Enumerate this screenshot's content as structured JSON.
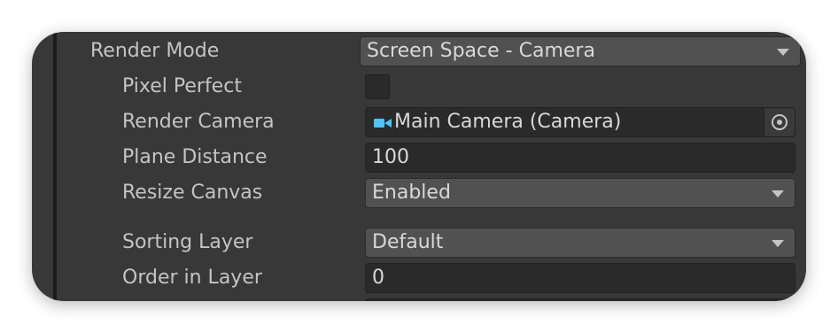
{
  "rows": {
    "render_mode": {
      "label": "Render Mode",
      "value": "Screen Space - Camera"
    },
    "pixel_perfect": {
      "label": "Pixel Perfect",
      "checked": false
    },
    "render_camera": {
      "label": "Render Camera",
      "value": "Main Camera (Camera)",
      "icon": "camera-icon"
    },
    "plane_distance": {
      "label": "Plane Distance",
      "value": "100"
    },
    "resize_canvas": {
      "label": "Resize Canvas",
      "value": "Enabled"
    },
    "sorting_layer": {
      "label": "Sorting Layer",
      "value": "Default"
    },
    "order_in_layer": {
      "label": "Order in Layer",
      "value": "0"
    }
  },
  "colors": {
    "panel_bg": "#383838",
    "dropdown_bg": "#515151",
    "field_bg": "#2a2a2a",
    "camera_icon": "#4fc3f7"
  }
}
